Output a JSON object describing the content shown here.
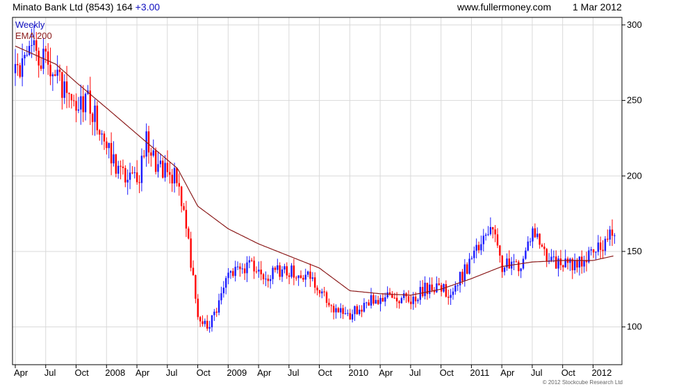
{
  "header": {
    "title": "Minato Bank Ltd (8543) 164",
    "change": "+3.00",
    "website": "www.fullermoney.com",
    "date": "1 Mar 2012"
  },
  "legend": {
    "period": "Weekly",
    "ema": "EMA 200"
  },
  "footer": {
    "copyright": "© 2012 Stockcube Research Ltd"
  },
  "colors": {
    "up": "#1a1aff",
    "down": "#ff0000",
    "ema": "#8b1a1a",
    "grid": "#d9d9d9"
  },
  "chart_data": {
    "type": "candlestick",
    "period": "weekly",
    "x_range": [
      "2007-04",
      "2012-03"
    ],
    "y_axis": {
      "side": "right",
      "ylim": [
        75,
        305
      ],
      "ticks": [
        100,
        150,
        200,
        250,
        300
      ]
    },
    "x_tick_labels": [
      "Apr",
      "Jul",
      "Oct",
      "2008",
      "Apr",
      "Jul",
      "Oct",
      "2009",
      "Apr",
      "Jul",
      "Oct",
      "2010",
      "Apr",
      "Jul",
      "Oct",
      "2011",
      "Apr",
      "Jul",
      "Oct",
      "2012"
    ],
    "grid": true,
    "price_close": [
      {
        "date": "2007-04",
        "value": 268
      },
      {
        "date": "2007-06",
        "value": 282
      },
      {
        "date": "2007-08",
        "value": 265
      },
      {
        "date": "2007-10",
        "value": 240
      },
      {
        "date": "2007-11",
        "value": 255
      },
      {
        "date": "2008-01",
        "value": 220
      },
      {
        "date": "2008-02",
        "value": 205
      },
      {
        "date": "2008-04",
        "value": 195
      },
      {
        "date": "2008-05",
        "value": 225
      },
      {
        "date": "2008-06",
        "value": 205
      },
      {
        "date": "2008-08",
        "value": 200
      },
      {
        "date": "2008-09",
        "value": 162
      },
      {
        "date": "2008-10",
        "value": 105
      },
      {
        "date": "2008-11",
        "value": 100
      },
      {
        "date": "2008-12",
        "value": 115
      },
      {
        "date": "2009-01",
        "value": 135
      },
      {
        "date": "2009-03",
        "value": 140
      },
      {
        "date": "2009-05",
        "value": 135
      },
      {
        "date": "2009-07",
        "value": 138
      },
      {
        "date": "2009-09",
        "value": 132
      },
      {
        "date": "2009-11",
        "value": 115
      },
      {
        "date": "2010-01",
        "value": 108
      },
      {
        "date": "2010-03",
        "value": 118
      },
      {
        "date": "2010-05",
        "value": 120
      },
      {
        "date": "2010-07",
        "value": 118
      },
      {
        "date": "2010-09",
        "value": 128
      },
      {
        "date": "2010-11",
        "value": 122
      },
      {
        "date": "2011-01",
        "value": 145
      },
      {
        "date": "2011-03",
        "value": 165
      },
      {
        "date": "2011-04",
        "value": 140
      },
      {
        "date": "2011-06",
        "value": 142
      },
      {
        "date": "2011-07",
        "value": 165
      },
      {
        "date": "2011-09",
        "value": 142
      },
      {
        "date": "2011-11",
        "value": 142
      },
      {
        "date": "2012-01",
        "value": 148
      },
      {
        "date": "2012-03",
        "value": 164
      }
    ],
    "ema200": [
      {
        "date": "2007-04",
        "value": 286
      },
      {
        "date": "2007-08",
        "value": 274
      },
      {
        "date": "2007-10",
        "value": 262
      },
      {
        "date": "2008-01",
        "value": 245
      },
      {
        "date": "2008-05",
        "value": 222
      },
      {
        "date": "2008-08",
        "value": 205
      },
      {
        "date": "2008-10",
        "value": 180
      },
      {
        "date": "2009-01",
        "value": 165
      },
      {
        "date": "2009-04",
        "value": 155
      },
      {
        "date": "2009-07",
        "value": 147
      },
      {
        "date": "2009-10",
        "value": 139
      },
      {
        "date": "2010-01",
        "value": 124
      },
      {
        "date": "2010-04",
        "value": 122
      },
      {
        "date": "2010-07",
        "value": 121
      },
      {
        "date": "2010-10",
        "value": 125
      },
      {
        "date": "2011-01",
        "value": 132
      },
      {
        "date": "2011-04",
        "value": 140
      },
      {
        "date": "2011-07",
        "value": 143
      },
      {
        "date": "2011-10",
        "value": 144
      },
      {
        "date": "2012-01",
        "value": 144
      },
      {
        "date": "2012-03",
        "value": 147
      }
    ]
  }
}
